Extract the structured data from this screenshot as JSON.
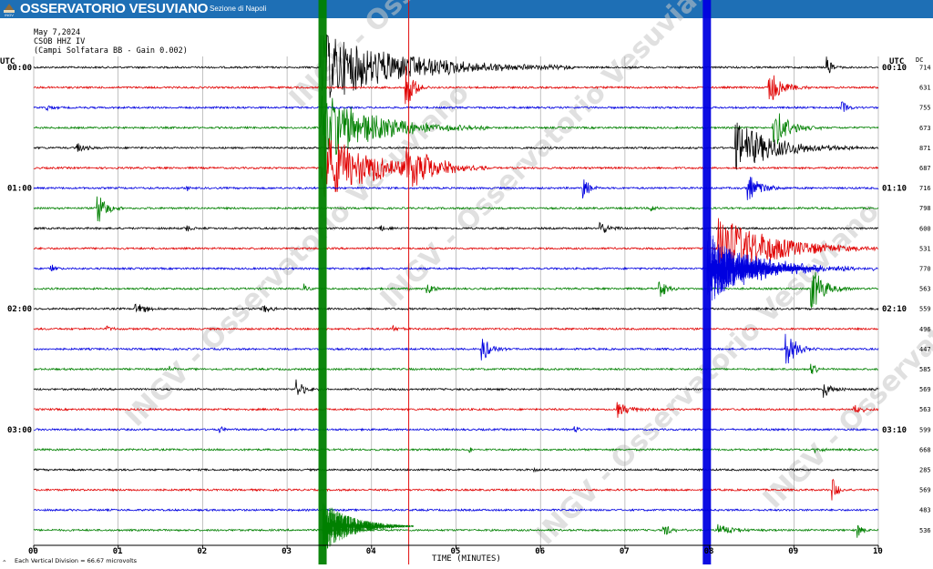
{
  "header": {
    "title": "OSSERVATORIO VESUVIANO",
    "subtitle": "Sezione di Napoli",
    "logo_text": "INGV",
    "bg_color": "#1e6fb5"
  },
  "info": {
    "date": "May 7,2024",
    "station": "CSOB HHZ IV",
    "description": "(Campi Solfatara BB - Gain 0.002)"
  },
  "watermark": "INGV - Osservatorio Vesuviano",
  "chart_data": {
    "type": "seismogram",
    "xlabel": "TIME (MINUTES)",
    "x_ticks": [
      "00",
      "01",
      "02",
      "03",
      "04",
      "05",
      "06",
      "07",
      "08",
      "09",
      "10"
    ],
    "xlim": [
      0,
      10
    ],
    "left_axis_label": "UTC",
    "right_axis_label": "UTC",
    "right_col_header": "DC",
    "left_time_labels": [
      {
        "row": 0,
        "label": "00:00"
      },
      {
        "row": 6,
        "label": "01:00"
      },
      {
        "row": 12,
        "label": "02:00"
      },
      {
        "row": 18,
        "label": "03:00"
      }
    ],
    "right_time_labels": [
      {
        "row": 0,
        "label": "00:10"
      },
      {
        "row": 6,
        "label": "01:10"
      },
      {
        "row": 12,
        "label": "02:10"
      },
      {
        "row": 18,
        "label": "03:10"
      }
    ],
    "trace_colors": [
      "#000000",
      "#e00000",
      "#0000e0",
      "#008000"
    ],
    "dc_offsets": [
      714,
      631,
      755,
      673,
      871,
      687,
      716,
      798,
      600,
      531,
      770,
      563,
      559,
      496,
      447,
      585,
      569,
      563,
      599,
      668,
      285,
      569,
      483,
      536
    ],
    "noise_amplitude": 1.0,
    "events": [
      {
        "row": 0,
        "t": 3.4,
        "amp": 40,
        "dur": 3.0
      },
      {
        "row": 0,
        "t": 9.38,
        "amp": 14,
        "dur": 0.2
      },
      {
        "row": 1,
        "t": 8.7,
        "amp": 22,
        "dur": 0.5
      },
      {
        "row": 1,
        "t": 4.4,
        "amp": 30,
        "dur": 0.3
      },
      {
        "row": 2,
        "t": 9.55,
        "amp": 12,
        "dur": 0.2
      },
      {
        "row": 2,
        "t": 0.15,
        "amp": 5,
        "dur": 0.2
      },
      {
        "row": 3,
        "t": 3.4,
        "amp": 40,
        "dur": 2.0
      },
      {
        "row": 3,
        "t": 8.75,
        "amp": 25,
        "dur": 0.6
      },
      {
        "row": 4,
        "t": 0.5,
        "amp": 7,
        "dur": 0.3
      },
      {
        "row": 4,
        "t": 8.3,
        "amp": 30,
        "dur": 1.5
      },
      {
        "row": 5,
        "t": 4.4,
        "amp": 28,
        "dur": 1.0
      },
      {
        "row": 5,
        "t": 3.4,
        "amp": 40,
        "dur": 2.0
      },
      {
        "row": 6,
        "t": 8.45,
        "amp": 18,
        "dur": 0.5
      },
      {
        "row": 6,
        "t": 6.5,
        "amp": 12,
        "dur": 0.3
      },
      {
        "row": 6,
        "t": 1.8,
        "amp": 4,
        "dur": 0.2
      },
      {
        "row": 7,
        "t": 0.75,
        "amp": 22,
        "dur": 0.3
      },
      {
        "row": 7,
        "t": 7.3,
        "amp": 6,
        "dur": 0.2
      },
      {
        "row": 8,
        "t": 6.7,
        "amp": 10,
        "dur": 0.3
      },
      {
        "row": 8,
        "t": 4.1,
        "amp": 5,
        "dur": 0.2
      },
      {
        "row": 8,
        "t": 1.8,
        "amp": 5,
        "dur": 0.2
      },
      {
        "row": 9,
        "t": 8.1,
        "amp": 40,
        "dur": 2.0
      },
      {
        "row": 10,
        "t": 8.2,
        "amp": 25,
        "dur": 2.0
      },
      {
        "row": 10,
        "t": 0.2,
        "amp": 5,
        "dur": 0.2
      },
      {
        "row": 11,
        "t": 9.2,
        "amp": 28,
        "dur": 0.5
      },
      {
        "row": 11,
        "t": 4.65,
        "amp": 12,
        "dur": 0.2
      },
      {
        "row": 11,
        "t": 7.4,
        "amp": 12,
        "dur": 0.3
      },
      {
        "row": 11,
        "t": 3.2,
        "amp": 6,
        "dur": 0.2
      },
      {
        "row": 12,
        "t": 1.2,
        "amp": 7,
        "dur": 0.5
      },
      {
        "row": 12,
        "t": 2.7,
        "amp": 6,
        "dur": 0.3
      },
      {
        "row": 13,
        "t": 0.85,
        "amp": 5,
        "dur": 0.2
      },
      {
        "row": 13,
        "t": 4.25,
        "amp": 6,
        "dur": 0.2
      },
      {
        "row": 14,
        "t": 5.3,
        "amp": 18,
        "dur": 0.3
      },
      {
        "row": 14,
        "t": 8.9,
        "amp": 22,
        "dur": 0.4
      },
      {
        "row": 15,
        "t": 1.6,
        "amp": 5,
        "dur": 0.2
      },
      {
        "row": 15,
        "t": 9.2,
        "amp": 8,
        "dur": 0.2
      },
      {
        "row": 16,
        "t": 3.1,
        "amp": 12,
        "dur": 0.3
      },
      {
        "row": 16,
        "t": 9.35,
        "amp": 12,
        "dur": 0.3
      },
      {
        "row": 17,
        "t": 6.9,
        "amp": 10,
        "dur": 0.5
      },
      {
        "row": 17,
        "t": 9.7,
        "amp": 8,
        "dur": 0.3
      },
      {
        "row": 18,
        "t": 2.2,
        "amp": 4,
        "dur": 0.2
      },
      {
        "row": 18,
        "t": 6.4,
        "amp": 4,
        "dur": 0.2
      },
      {
        "row": 19,
        "t": 5.15,
        "amp": 4,
        "dur": 0.2
      },
      {
        "row": 19,
        "t": 9.25,
        "amp": 5,
        "dur": 0.2
      },
      {
        "row": 20,
        "t": 5.9,
        "amp": 3,
        "dur": 0.2
      },
      {
        "row": 21,
        "t": 9.45,
        "amp": 16,
        "dur": 0.2
      },
      {
        "row": 23,
        "t": 7.45,
        "amp": 8,
        "dur": 0.3
      },
      {
        "row": 23,
        "t": 9.75,
        "amp": 10,
        "dur": 0.2
      },
      {
        "row": 23,
        "t": 8.1,
        "amp": 8,
        "dur": 0.5
      }
    ],
    "big_events": [
      {
        "t": 3.42,
        "color": "#008000",
        "width": 9,
        "top_row": 0,
        "bottom_row": 23
      },
      {
        "t": 4.44,
        "color": "#e00000",
        "width": 1,
        "top_row": 0,
        "bottom_row": 23
      },
      {
        "t": 7.97,
        "color": "#0000e0",
        "width": 9,
        "top_row": 0,
        "bottom_row": 23
      }
    ]
  },
  "footer": {
    "note": "Each Vertical Division =  66.67 microvolts"
  }
}
